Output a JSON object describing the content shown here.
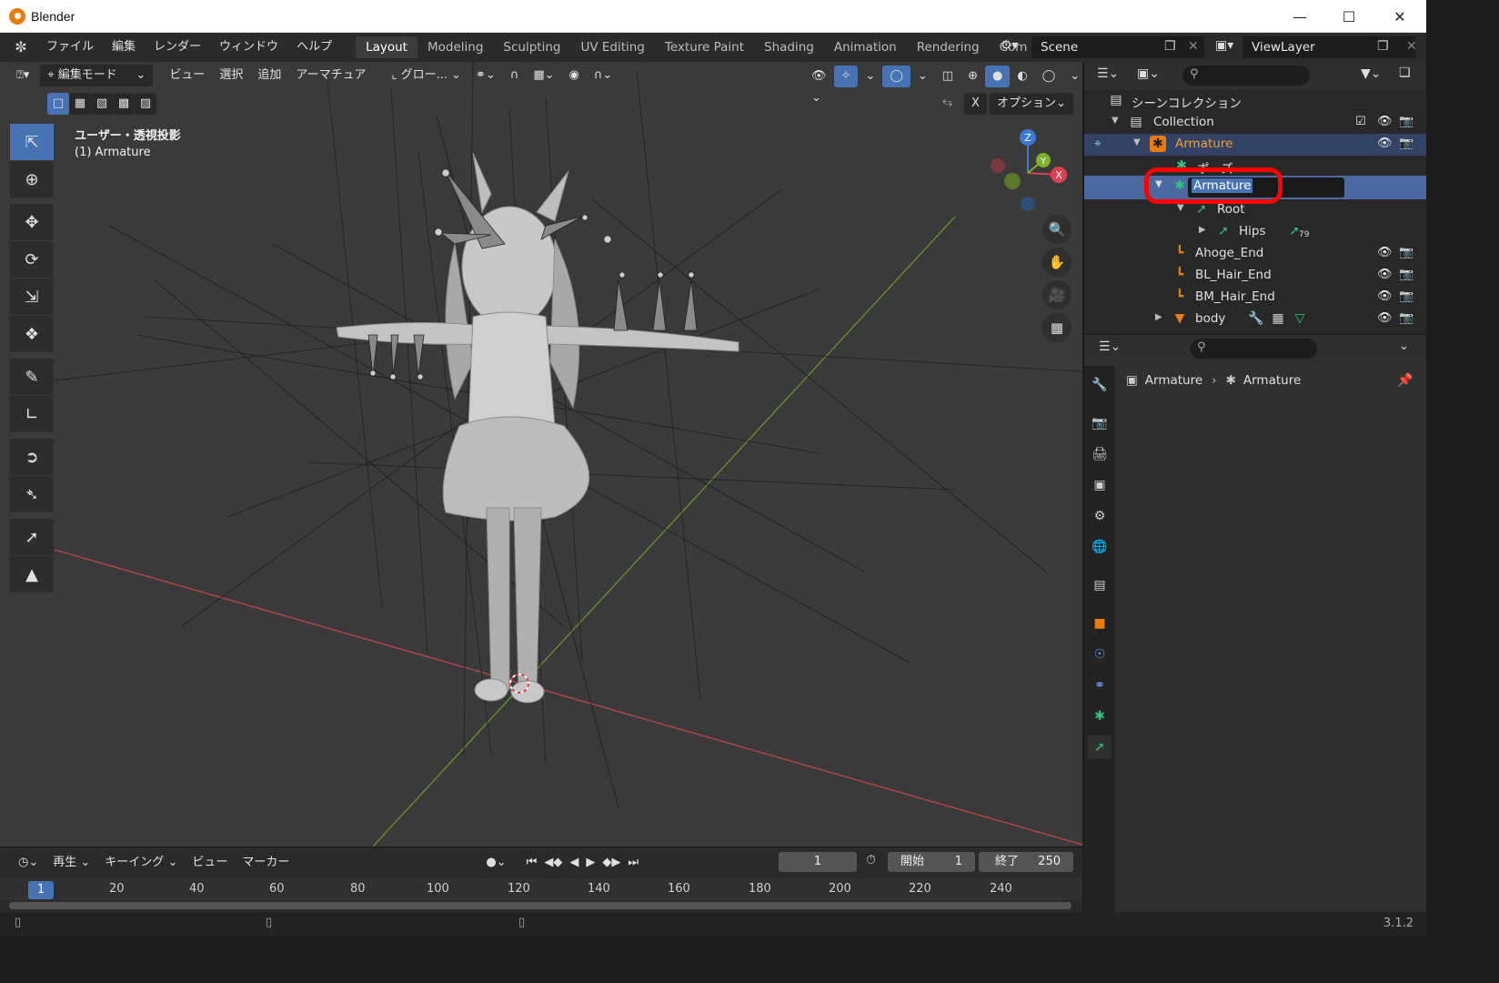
{
  "window": {
    "title": "Blender"
  },
  "menus": [
    "ファイル",
    "編集",
    "レンダー",
    "ウィンドウ",
    "ヘルプ"
  ],
  "workspaces": [
    "Layout",
    "Modeling",
    "Sculpting",
    "UV Editing",
    "Texture Paint",
    "Shading",
    "Animation",
    "Rendering",
    "Com"
  ],
  "scene": {
    "name": "Scene",
    "view_layer": "ViewLayer"
  },
  "viewport": {
    "mode": "編集モード",
    "header_menus": [
      "ビュー",
      "選択",
      "追加",
      "アーマチュア"
    ],
    "transform_orientation": "グロー...",
    "options_label": "オプション",
    "x_label": "X",
    "view_name": "ユーザー・透視投影",
    "object_name": "(1) Armature",
    "gizmo": {
      "x": "X",
      "y": "Y",
      "z": "Z"
    }
  },
  "outliner": {
    "rows": [
      {
        "label": "シーンコレクション"
      },
      {
        "label": "Collection"
      },
      {
        "label": "Armature"
      },
      {
        "label": "ポーズ"
      },
      {
        "label": "Armature"
      },
      {
        "label": "Root"
      },
      {
        "label": "Hips",
        "badge": "79"
      },
      {
        "label": "Ahoge_End"
      },
      {
        "label": "BL_Hair_End"
      },
      {
        "label": "BM_Hair_End"
      },
      {
        "label": "body"
      }
    ]
  },
  "properties": {
    "breadcrumb_object": "Armature",
    "breadcrumb_data": "Armature"
  },
  "timeline": {
    "menus": [
      "再生",
      "キーイング",
      "ビュー",
      "マーカー"
    ],
    "current_frame": "1",
    "start_label": "開始",
    "start": "1",
    "end_label": "終了",
    "end": "250",
    "ruler": [
      "1",
      "20",
      "40",
      "60",
      "80",
      "100",
      "120",
      "140",
      "160",
      "180",
      "200",
      "220",
      "240"
    ]
  },
  "status": {
    "version": "3.1.2"
  },
  "colors": {
    "accent": "#4772b3",
    "selected_row": "#4c68a0",
    "highlight_red": "#ff0000",
    "bone_green": "#2ec27e"
  }
}
